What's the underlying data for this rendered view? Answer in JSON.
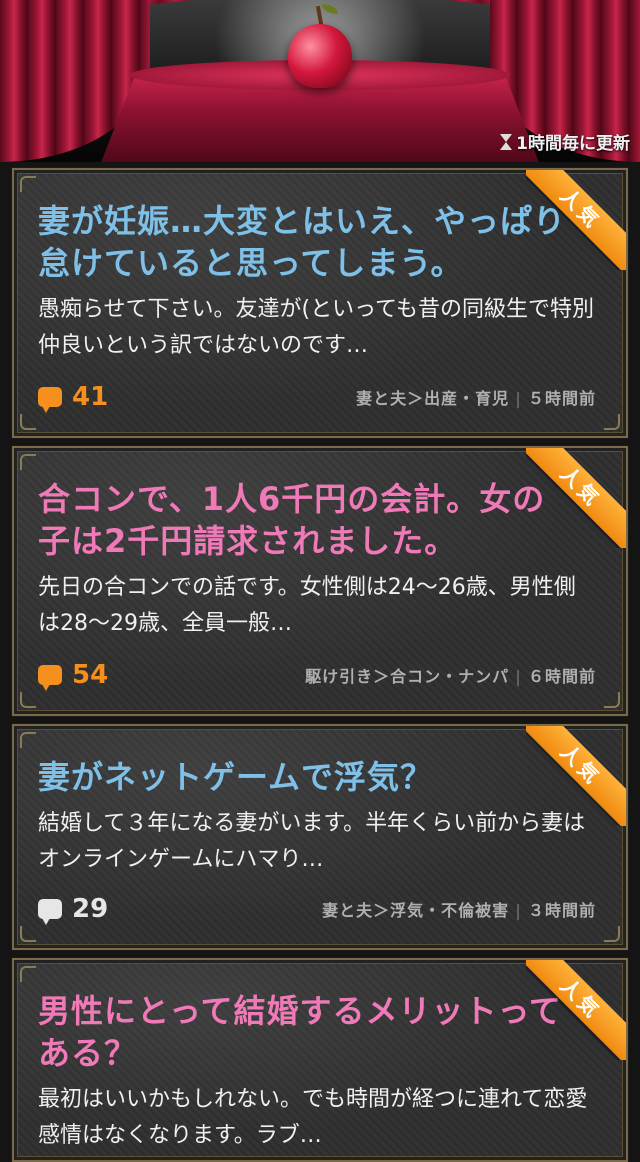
{
  "header": {
    "update_text": "1時間毎に更新",
    "icon": "hourglass-icon"
  },
  "badge_label": "人気",
  "colors": {
    "accent_orange": "#f5901e",
    "title_blue": "#7fc0e8",
    "title_pink": "#f07ab8"
  },
  "posts": [
    {
      "title": "妻が妊娠…大変とはいえ、やっぱり怠けていると思ってしまう。",
      "snippet": "愚痴らせて下さい。友達が(といっても昔の同級生で特別仲良いという訳ではないのです…",
      "comments": "41",
      "category": "妻と夫＞出産・育児",
      "time": "５時間前"
    },
    {
      "title": "合コンで、1人6千円の会計。女の子は2千円請求されました。",
      "snippet": "先日の合コンでの話です。女性側は24〜26歳、男性側は28〜29歳、全員一般…",
      "comments": "54",
      "category": "駆け引き＞合コン・ナンパ",
      "time": "６時間前"
    },
    {
      "title": "妻がネットゲームで浮気？",
      "snippet": "結婚して３年になる妻がいます。半年くらい前から妻はオンラインゲームにハマり…",
      "comments": "29",
      "category": "妻と夫＞浮気・不倫被害",
      "time": "３時間前"
    },
    {
      "title": "男性にとって結婚するメリットってある？",
      "snippet": "最初はいいかもしれない。でも時間が経つに連れて恋愛感情はなくなります。ラブ…"
    }
  ]
}
